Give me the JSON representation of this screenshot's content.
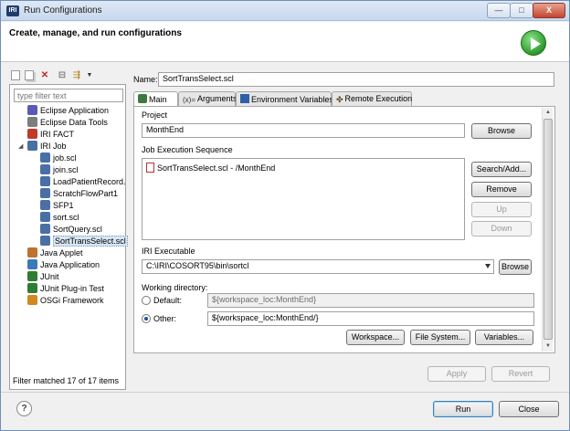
{
  "window": {
    "title": "Run Configurations",
    "app_icon_text": "IRI",
    "minimize": "—",
    "maximize": "□",
    "close": "X"
  },
  "banner": {
    "title": "Create, manage, and run configurations"
  },
  "left": {
    "filter_placeholder": "type filter text",
    "tree": [
      {
        "label": "Eclipse Application",
        "icon": "eclipse-app-icon",
        "color": "#5a5ab8",
        "level": 1
      },
      {
        "label": "Eclipse Data Tools",
        "icon": "data-tools-icon",
        "color": "#7d7d7d",
        "level": 1
      },
      {
        "label": "IRI FACT",
        "icon": "iri-fact-icon",
        "color": "#c0392b",
        "level": 1
      },
      {
        "label": "IRI Job",
        "icon": "iri-job-icon",
        "color": "#4a6fa5",
        "level": 1,
        "expanded": true
      },
      {
        "label": "job.scl",
        "icon": "scl-file-icon",
        "color": "#4a6fa5",
        "level": 2
      },
      {
        "label": "join.scl",
        "icon": "scl-file-icon",
        "color": "#4a6fa5",
        "level": 2
      },
      {
        "label": "LoadPatientRecord.",
        "icon": "scl-file-icon",
        "color": "#4a6fa5",
        "level": 2
      },
      {
        "label": "ScratchFlowPart1",
        "icon": "scl-file-icon",
        "color": "#4a6fa5",
        "level": 2
      },
      {
        "label": "SFP1",
        "icon": "scl-file-icon",
        "color": "#4a6fa5",
        "level": 2
      },
      {
        "label": "sort.scl",
        "icon": "scl-file-icon",
        "color": "#4a6fa5",
        "level": 2
      },
      {
        "label": "SortQuery.scl",
        "icon": "scl-file-icon",
        "color": "#4a6fa5",
        "level": 2
      },
      {
        "label": "SortTransSelect.scl",
        "icon": "scl-file-icon",
        "color": "#4a6fa5",
        "level": 2,
        "selected": true
      },
      {
        "label": "Java Applet",
        "icon": "java-applet-icon",
        "color": "#c07030",
        "level": 1
      },
      {
        "label": "Java Application",
        "icon": "java-app-icon",
        "color": "#3a7ab8",
        "level": 1
      },
      {
        "label": "JUnit",
        "icon": "junit-icon",
        "color": "#2e7d32",
        "level": 1
      },
      {
        "label": "JUnit Plug-in Test",
        "icon": "junit-plugin-icon",
        "color": "#2e7d32",
        "level": 1
      },
      {
        "label": "OSGi Framework",
        "icon": "osgi-icon",
        "color": "#d08a20",
        "level": 1
      }
    ],
    "filter_status": "Filter matched 17 of 17 items"
  },
  "config": {
    "name_label": "Name:",
    "name_value": "SortTransSelect.scl",
    "tabs": [
      {
        "label": "Main",
        "icon": "main-tab-icon",
        "active": true
      },
      {
        "label": "Arguments",
        "icon": "arguments-icon",
        "active": false
      },
      {
        "label": "Environment Variables",
        "icon": "environment-icon",
        "active": false
      },
      {
        "label": "Remote Execution",
        "icon": "remote-execution-icon",
        "active": false
      }
    ],
    "project_label": "Project",
    "project_value": "MonthEnd",
    "browse_label": "Browse",
    "sequence_label": "Job Execution Sequence",
    "sequence_items": [
      "SortTransSelect.scl - /MonthEnd"
    ],
    "search_add_label": "Search/Add...",
    "remove_label": "Remove",
    "up_label": "Up",
    "down_label": "Down",
    "executable_label": "IRI Executable",
    "executable_value": "C:\\IRI\\COSORT95\\bin\\sortcl",
    "working_dir_label": "Working directory:",
    "default_label": "Default:",
    "default_value": "${workspace_loc:MonthEnd}",
    "other_label": "Other:",
    "other_value": "${workspace_loc:MonthEnd/}",
    "workspace_btn": "Workspace...",
    "filesystem_btn": "File System...",
    "variables_btn": "Variables...",
    "apply_label": "Apply",
    "revert_label": "Revert"
  },
  "footer": {
    "help_label": "?",
    "run_label": "Run",
    "close_label": "Close"
  },
  "colors": {
    "accent": "#3c7fb1",
    "selection": "#d9e6f4",
    "run_green": "#2a9a2a"
  }
}
